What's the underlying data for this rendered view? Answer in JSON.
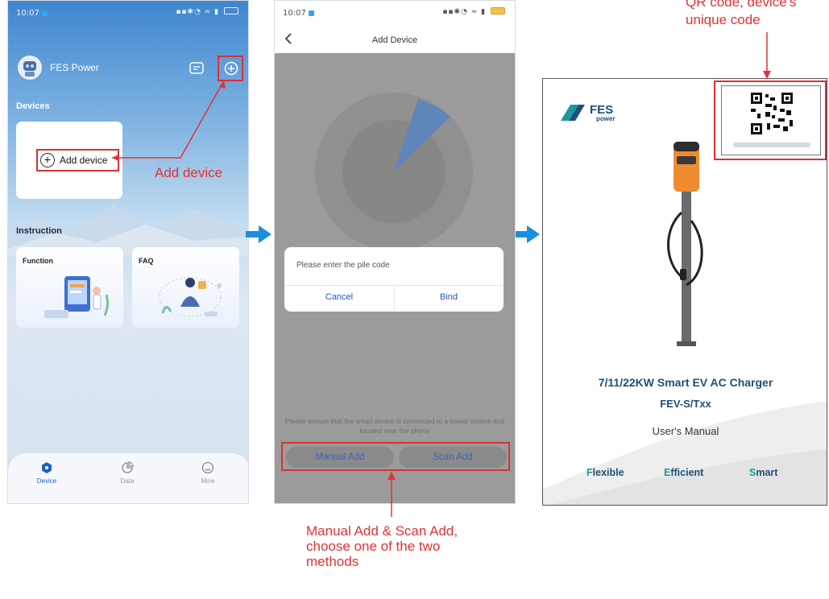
{
  "phone1": {
    "status": {
      "time": "10:07"
    },
    "brand": {
      "name": "FES Power"
    },
    "sections": {
      "devices": "Devices",
      "instruction": "Instruction"
    },
    "add_device_label": "Add device",
    "cards": {
      "function": "Function",
      "faq": "FAQ"
    },
    "tabs": [
      {
        "label": "Device"
      },
      {
        "label": "Data"
      },
      {
        "label": "Mine"
      }
    ],
    "annotation": "Add device"
  },
  "phone2": {
    "status": {
      "time": "10:07"
    },
    "title": "Add Device",
    "dialog": {
      "placeholder": "Please enter the pile code",
      "cancel": "Cancel",
      "bind": "Bind"
    },
    "hint": "Please ensure that the smart device is connected to a power source and located near the phone",
    "buttons": {
      "manual": "Manual Add",
      "scan": "Scan Add"
    }
  },
  "manual": {
    "title": "7/11/22KW Smart EV AC Charger",
    "model": "FEV-S/Txx",
    "subtitle": "User's Manual",
    "taglines": [
      {
        "cap": "F",
        "rest": "lexible"
      },
      {
        "cap": "E",
        "rest": "fficient"
      },
      {
        "cap": "S",
        "rest": "mart"
      }
    ]
  },
  "annotations": {
    "qr_line1": "QR code, device's",
    "qr_line2": "unique code",
    "methods_line1": "Manual Add & Scan Add,",
    "methods_line2": "choose one of the two",
    "methods_line3": "methods"
  },
  "colors": {
    "annotation_red": "#e23232",
    "arrow_blue": "#1a8fe0",
    "link_blue": "#2558b8",
    "manual_navy": "#1d4f7a",
    "manual_teal": "#1a9a9a"
  }
}
